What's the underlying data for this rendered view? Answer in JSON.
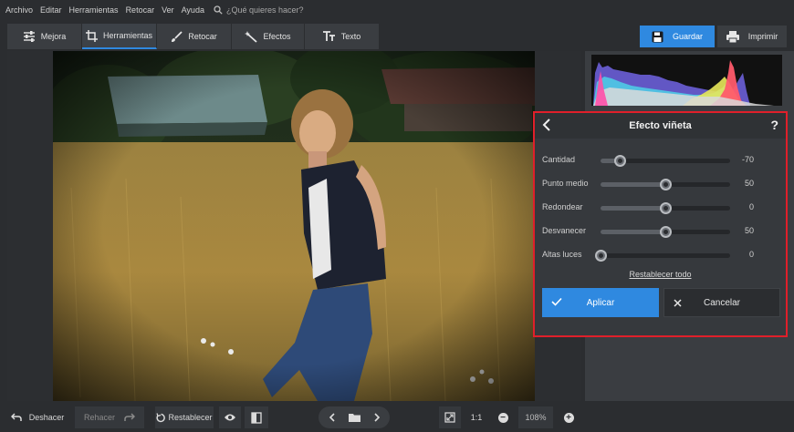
{
  "menu": {
    "items": [
      "Archivo",
      "Editar",
      "Herramientas",
      "Retocar",
      "Ver",
      "Ayuda"
    ],
    "search_placeholder": "¿Qué quieres hacer?"
  },
  "tabs": [
    {
      "label": "Mejora",
      "icon": "sliders-icon",
      "active": false
    },
    {
      "label": "Herramientas",
      "icon": "crop-icon",
      "active": true
    },
    {
      "label": "Retocar",
      "icon": "brush-icon",
      "active": false
    },
    {
      "label": "Efectos",
      "icon": "magic-wand-icon",
      "active": false
    },
    {
      "label": "Texto",
      "icon": "text-icon",
      "active": false
    }
  ],
  "actions": {
    "save_label": "Guardar",
    "print_label": "Imprimir"
  },
  "vignette": {
    "title": "Efecto viñeta",
    "help": "?",
    "sliders": [
      {
        "label": "Cantidad",
        "value": "-70",
        "fraction": 0.15
      },
      {
        "label": "Punto medio",
        "value": "50",
        "fraction": 0.5
      },
      {
        "label": "Redondear",
        "value": "0",
        "fraction": 0.5
      },
      {
        "label": "Desvanecer",
        "value": "50",
        "fraction": 0.5
      },
      {
        "label": "Altas luces",
        "value": "0",
        "fraction": 0.0
      }
    ],
    "reset_all": "Restablecer todo",
    "apply_label": "Aplicar",
    "cancel_label": "Cancelar"
  },
  "bottom": {
    "undo_label": "Deshacer",
    "redo_label": "Rehacer",
    "reset_label": "Restablecer",
    "one_to_one": "1:1",
    "zoom": "108%"
  },
  "colors": {
    "accent": "#2f89e0",
    "highlight_border": "#e01f2a"
  }
}
